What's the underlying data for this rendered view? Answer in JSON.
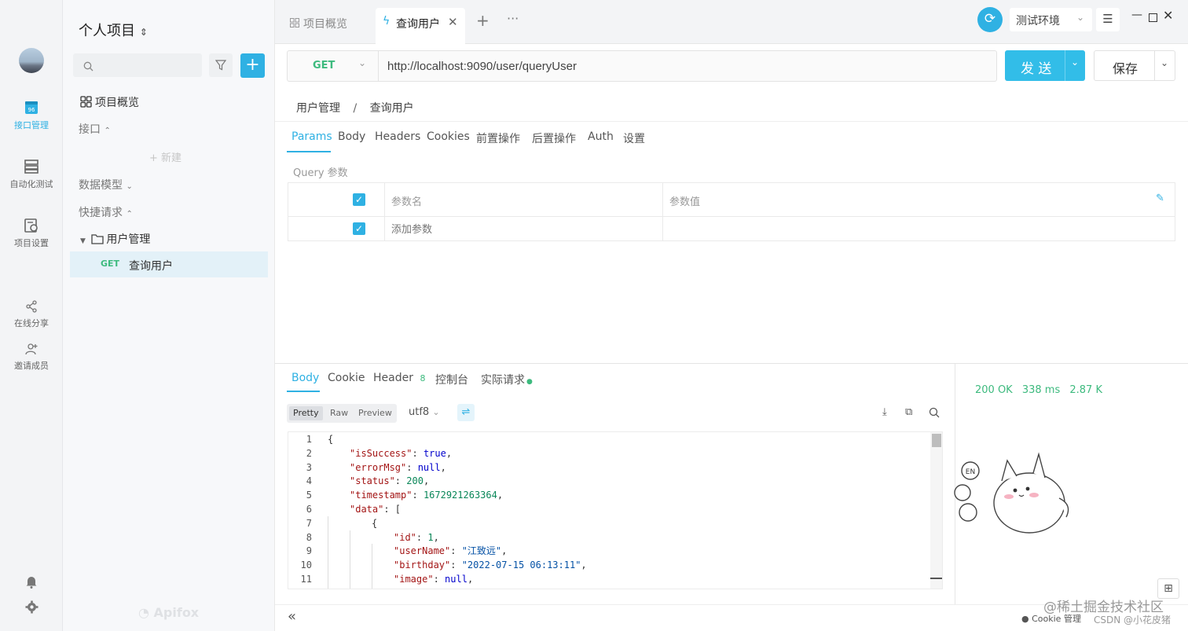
{
  "rail": {
    "items": [
      {
        "label": "接口管理",
        "icon": "api-icon",
        "active": true
      },
      {
        "label": "自动化测试",
        "icon": "automation-icon"
      },
      {
        "label": "项目设置",
        "icon": "settings-doc-icon"
      },
      {
        "label": "在线分享",
        "icon": "share-icon"
      },
      {
        "label": "邀请成员",
        "icon": "add-user-icon"
      }
    ]
  },
  "sidebar": {
    "project_title": "个人项目",
    "search_placeholder": "",
    "overview": "项目概览",
    "api_section": "接口",
    "new_label": "新建",
    "schema_section": "数据模型",
    "quick_section": "快捷请求",
    "folder": "用户管理",
    "request_method": "GET",
    "request_name": "查询用户",
    "brand": "Apifox"
  },
  "tabs": [
    {
      "label": "项目概览",
      "active": false
    },
    {
      "label": "查询用户",
      "active": true
    }
  ],
  "topbar": {
    "env": "测试环境"
  },
  "request": {
    "method": "GET",
    "url": "http://localhost:9090/user/queryUser",
    "send": "发 送",
    "save": "保存"
  },
  "breadcrumb": {
    "folder": "用户管理",
    "sep": "/",
    "name": "查询用户"
  },
  "param_tabs": [
    "Params",
    "Body",
    "Headers",
    "Cookies",
    "前置操作",
    "后置操作",
    "Auth",
    "设置"
  ],
  "params": {
    "query_label": "Query 参数",
    "col_name": "参数名",
    "col_value": "参数值",
    "add_placeholder": "添加参数"
  },
  "response": {
    "tabs": [
      "Body",
      "Cookie",
      "Header",
      "控制台",
      "实际请求"
    ],
    "header_count": "8",
    "formats": [
      "Pretty",
      "Raw",
      "Preview"
    ],
    "encoding": "utf8",
    "status": "200 OK",
    "time": "338 ms",
    "size": "2.87 K",
    "code_lines": [
      {
        "ln": "1",
        "indent": 0,
        "parts": [
          {
            "t": "{",
            "c": "p"
          }
        ]
      },
      {
        "ln": "2",
        "indent": 1,
        "parts": [
          {
            "t": "\"isSuccess\"",
            "c": "k"
          },
          {
            "t": ": ",
            "c": "p"
          },
          {
            "t": "true",
            "c": "b"
          },
          {
            "t": ",",
            "c": "p"
          }
        ]
      },
      {
        "ln": "3",
        "indent": 1,
        "parts": [
          {
            "t": "\"errorMsg\"",
            "c": "k"
          },
          {
            "t": ": ",
            "c": "p"
          },
          {
            "t": "null",
            "c": "b"
          },
          {
            "t": ",",
            "c": "p"
          }
        ]
      },
      {
        "ln": "4",
        "indent": 1,
        "parts": [
          {
            "t": "\"status\"",
            "c": "k"
          },
          {
            "t": ": ",
            "c": "p"
          },
          {
            "t": "200",
            "c": "n"
          },
          {
            "t": ",",
            "c": "p"
          }
        ]
      },
      {
        "ln": "5",
        "indent": 1,
        "parts": [
          {
            "t": "\"timestamp\"",
            "c": "k"
          },
          {
            "t": ": ",
            "c": "p"
          },
          {
            "t": "1672921263364",
            "c": "n"
          },
          {
            "t": ",",
            "c": "p"
          }
        ]
      },
      {
        "ln": "6",
        "indent": 1,
        "parts": [
          {
            "t": "\"data\"",
            "c": "k"
          },
          {
            "t": ": [",
            "c": "p"
          }
        ]
      },
      {
        "ln": "7",
        "indent": 2,
        "parts": [
          {
            "t": "{",
            "c": "p"
          }
        ]
      },
      {
        "ln": "8",
        "indent": 3,
        "parts": [
          {
            "t": "\"id\"",
            "c": "k"
          },
          {
            "t": ": ",
            "c": "p"
          },
          {
            "t": "1",
            "c": "n"
          },
          {
            "t": ",",
            "c": "p"
          }
        ]
      },
      {
        "ln": "9",
        "indent": 3,
        "parts": [
          {
            "t": "\"userName\"",
            "c": "k"
          },
          {
            "t": ": ",
            "c": "p"
          },
          {
            "t": "\"江致远\"",
            "c": "s"
          },
          {
            "t": ",",
            "c": "p"
          }
        ]
      },
      {
        "ln": "10",
        "indent": 3,
        "parts": [
          {
            "t": "\"birthday\"",
            "c": "k"
          },
          {
            "t": ": ",
            "c": "p"
          },
          {
            "t": "\"2022-07-15 06:13:11\"",
            "c": "s"
          },
          {
            "t": ",",
            "c": "p"
          }
        ]
      },
      {
        "ln": "11",
        "indent": 3,
        "parts": [
          {
            "t": "\"image\"",
            "c": "k"
          },
          {
            "t": ": ",
            "c": "p"
          },
          {
            "t": "null",
            "c": "b"
          },
          {
            "t": ",",
            "c": "p"
          }
        ]
      }
    ]
  },
  "footer": {
    "cookie": "Cookie 管理",
    "watermark": "@稀土掘金技术社区",
    "csdn": "CSDN @小花皮猪"
  },
  "colors": {
    "accent": "#2fb1e3",
    "get": "#3dba7e",
    "success": "#3dba7e"
  }
}
